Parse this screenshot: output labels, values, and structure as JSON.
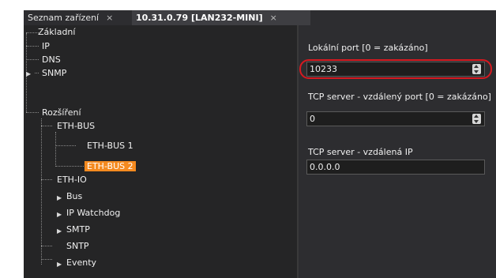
{
  "tabs": [
    {
      "label": "Seznam zařízení",
      "close": "×"
    },
    {
      "label": "10.31.0.79 [LAN232-MINI]",
      "close": "×"
    }
  ],
  "tree": {
    "items": [
      {
        "label": "Základní"
      },
      {
        "label": "IP"
      },
      {
        "label": "DNS"
      },
      {
        "label": "SNMP"
      },
      {
        "label": "Rozšíření"
      },
      {
        "label": "ETH-BUS"
      },
      {
        "label": "ETH-BUS 1"
      },
      {
        "label": "ETH-BUS 2",
        "selected": true
      },
      {
        "label": "ETH-IO"
      },
      {
        "label": "Bus"
      },
      {
        "label": "IP Watchdog"
      },
      {
        "label": "SMTP"
      },
      {
        "label": "SNTP"
      },
      {
        "label": "Eventy"
      }
    ]
  },
  "properties": {
    "local_port": {
      "label": "Lokální port [0 = zakázáno]",
      "value": "10233"
    },
    "tcp_remote_port": {
      "label": "TCP server - vzdálený port [0 = zakázáno]",
      "value": "0"
    },
    "tcp_remote_ip": {
      "label": "TCP server - vzdálená IP",
      "value": "0.0.0.0"
    }
  },
  "colors": {
    "selection": "#f58a1f",
    "highlight_ring": "#d71920",
    "panel": "#2d2d30",
    "tree_panel": "#252526"
  },
  "icons": {
    "expander": "triangle-right",
    "spinner": "spin-updown"
  }
}
